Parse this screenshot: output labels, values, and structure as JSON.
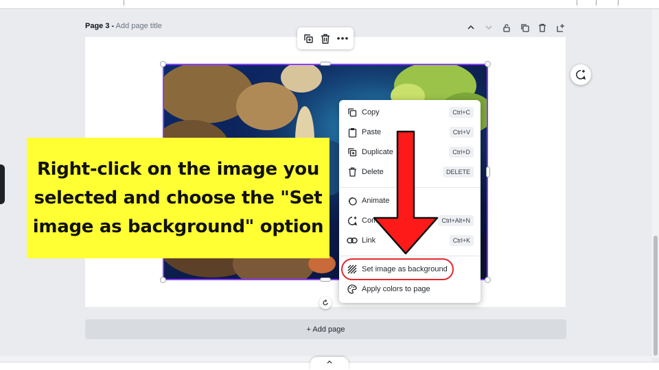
{
  "page": {
    "number_label": "Page 3 -",
    "title_placeholder": "Add page title",
    "add_page_label": "+ Add page"
  },
  "context_menu": {
    "items": [
      {
        "label": "Copy",
        "shortcut": "Ctrl+C",
        "icon": "copy-icon"
      },
      {
        "label": "Paste",
        "shortcut": "Ctrl+V",
        "icon": "paste-icon"
      },
      {
        "label": "Duplicate",
        "shortcut": "Ctrl+D",
        "icon": "duplicate-icon"
      },
      {
        "label": "Delete",
        "shortcut": "DELETE",
        "icon": "trash-icon"
      },
      {
        "label": "Animate",
        "shortcut": "",
        "icon": "animate-icon"
      },
      {
        "label": "Comment",
        "shortcut": "Ctrl+Alt+N",
        "icon": "comment-icon"
      },
      {
        "label": "Link",
        "shortcut": "Ctrl+K",
        "icon": "link-icon"
      },
      {
        "label": "Set image as background",
        "shortcut": "",
        "icon": "background-icon"
      },
      {
        "label": "Apply colors to page",
        "shortcut": "",
        "icon": "palette-icon"
      }
    ]
  },
  "callout": {
    "text": "Right-click on the image you selected and choose the \"Set image as background\" option"
  },
  "colors": {
    "selection": "#8b3dff",
    "highlight": "#e3262d",
    "callout_bg": "#ffff33",
    "arrow": "#ff1a1a"
  }
}
